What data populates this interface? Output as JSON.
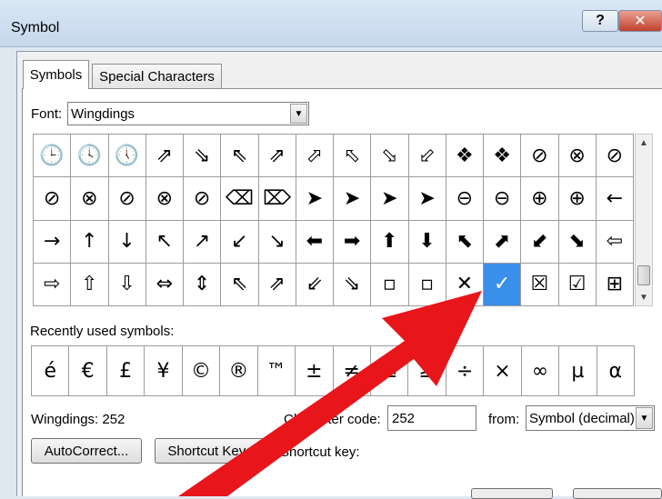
{
  "window": {
    "title": "Symbol",
    "help_label": "?",
    "close_label": "✕"
  },
  "tabs": [
    {
      "label": "Symbols"
    },
    {
      "label": "Special Characters"
    }
  ],
  "font": {
    "label": "Font:",
    "value": "Wingdings"
  },
  "symbol_grid": [
    [
      "🕒",
      "🕓",
      "🕔",
      "⇗",
      "⇘",
      "⇖",
      "⇗",
      "⬀",
      "⬁",
      "⬂",
      "⬃",
      "❖",
      "❖",
      "⊘",
      "⊗",
      "⊘"
    ],
    [
      "⊘",
      "⊗",
      "⊘",
      "⊗",
      "⊘",
      "⌫",
      "⌦",
      "➤",
      "➤",
      "➤",
      "➤",
      "⊖",
      "⊖",
      "⊕",
      "⊕",
      "←"
    ],
    [
      "→",
      "↑",
      "↓",
      "↖",
      "↗",
      "↙",
      "↘",
      "⬅",
      "➡",
      "⬆",
      "⬇",
      "⬉",
      "⬈",
      "⬋",
      "⬊",
      "⇦"
    ],
    [
      "⇨",
      "⇧",
      "⇩",
      "⇔",
      "⇕",
      "⇖",
      "⇗",
      "⇙",
      "⇘",
      "▫",
      "▫",
      "✕",
      "✓",
      "☒",
      "☑",
      "⊞"
    ]
  ],
  "selected_cell": {
    "row": 3,
    "col": 12
  },
  "recent": {
    "label": "Recently used symbols:",
    "symbols": [
      "é",
      "€",
      "£",
      "¥",
      "©",
      "®",
      "™",
      "±",
      "≠",
      "≤",
      "≥",
      "÷",
      "×",
      "∞",
      "µ",
      "α"
    ]
  },
  "status": {
    "font_code_label": "Wingdings: 252"
  },
  "character_code": {
    "label": "Character code:",
    "value": "252"
  },
  "from": {
    "label": "from:",
    "value": "Symbol (decimal)"
  },
  "buttons": {
    "autocorrect": "AutoCorrect...",
    "shortcut_key_button": "Shortcut Key...",
    "shortcut_key_label": "Shortcut key:"
  },
  "colors": {
    "selection": "#3a8fea",
    "arrow": "#e8151b"
  }
}
